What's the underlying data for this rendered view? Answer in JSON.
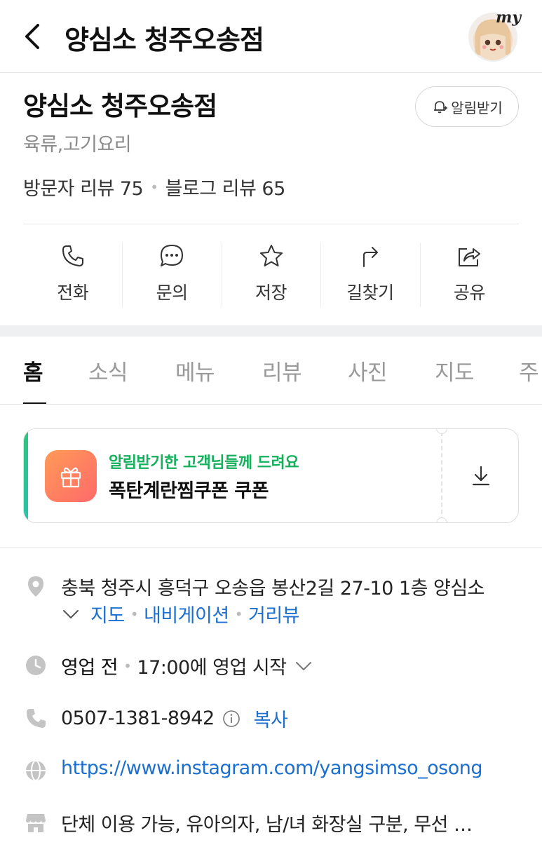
{
  "header": {
    "title": "양심소 청주오송점",
    "avatar_badge": "my"
  },
  "place": {
    "name": "양심소 청주오송점",
    "notify_label": "알림받기",
    "category": "육류,고기요리",
    "visitor_reviews": "방문자 리뷰 75",
    "blog_reviews": "블로그 리뷰 65"
  },
  "actions": [
    {
      "label": "전화",
      "icon": "phone-icon"
    },
    {
      "label": "문의",
      "icon": "chat-icon"
    },
    {
      "label": "저장",
      "icon": "star-icon"
    },
    {
      "label": "길찾기",
      "icon": "directions-icon"
    },
    {
      "label": "공유",
      "icon": "share-icon"
    }
  ],
  "tabs": [
    "홈",
    "소식",
    "메뉴",
    "리뷰",
    "사진",
    "지도",
    "주"
  ],
  "active_tab": "홈",
  "coupon": {
    "subtitle": "알림받기한 고객님들께 드려요",
    "title": "폭탄계란찜쿠폰 쿠폰",
    "icon": "gift-icon"
  },
  "info": {
    "address": "충북 청주시 흥덕구 오송읍 봉산2길 27-10 1층 양심소",
    "address_links": [
      "지도",
      "내비게이션",
      "거리뷰"
    ],
    "hours_status": "영업 전",
    "hours_detail": "17:00에 영업 시작",
    "phone": "0507-1381-8942",
    "copy_label": "복사",
    "website": "https://www.instagram.com/yangsimso_osong",
    "amenities": "단체 이용 가능, 유아의자, 남/녀 화장실 구분, 무선 …"
  },
  "colors": {
    "accent_green": "#14b05c",
    "link_blue": "#1a6fd0",
    "coupon_gradient_start": "#ff9a57",
    "coupon_gradient_end": "#ff6a6a"
  }
}
